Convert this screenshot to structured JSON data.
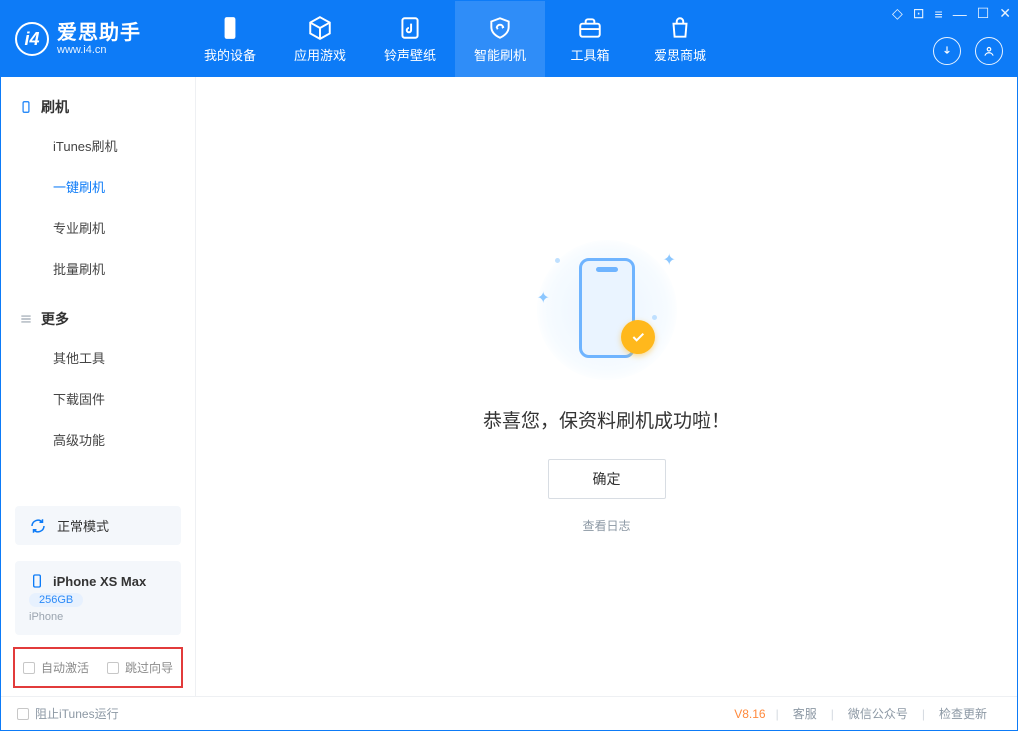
{
  "app": {
    "name_cn": "爱思助手",
    "url": "www.i4.cn"
  },
  "tabs": {
    "mydevice": "我的设备",
    "apps": "应用游戏",
    "ringtones": "铃声壁纸",
    "flash": "智能刷机",
    "toolbox": "工具箱",
    "store": "爱思商城"
  },
  "active_tab": "flash",
  "sidebar": {
    "g1_title": "刷机",
    "g1_items": {
      "itunes": "iTunes刷机",
      "onekey": "一键刷机",
      "pro": "专业刷机",
      "batch": "批量刷机"
    },
    "g1_active": "onekey",
    "g2_title": "更多",
    "g2_items": {
      "other": "其他工具",
      "firmware": "下载固件",
      "advanced": "高级功能"
    }
  },
  "mode": {
    "label": "正常模式"
  },
  "device": {
    "name": "iPhone XS Max",
    "storage": "256GB",
    "type": "iPhone"
  },
  "checks": {
    "auto_activate": "自动激活",
    "skip_guide": "跳过向导"
  },
  "result": {
    "title": "恭喜您，保资料刷机成功啦！",
    "ok": "确定",
    "log": "查看日志"
  },
  "footer": {
    "block_itunes": "阻止iTunes运行",
    "version": "V8.16",
    "support": "客服",
    "wechat": "微信公众号",
    "update": "检查更新"
  }
}
